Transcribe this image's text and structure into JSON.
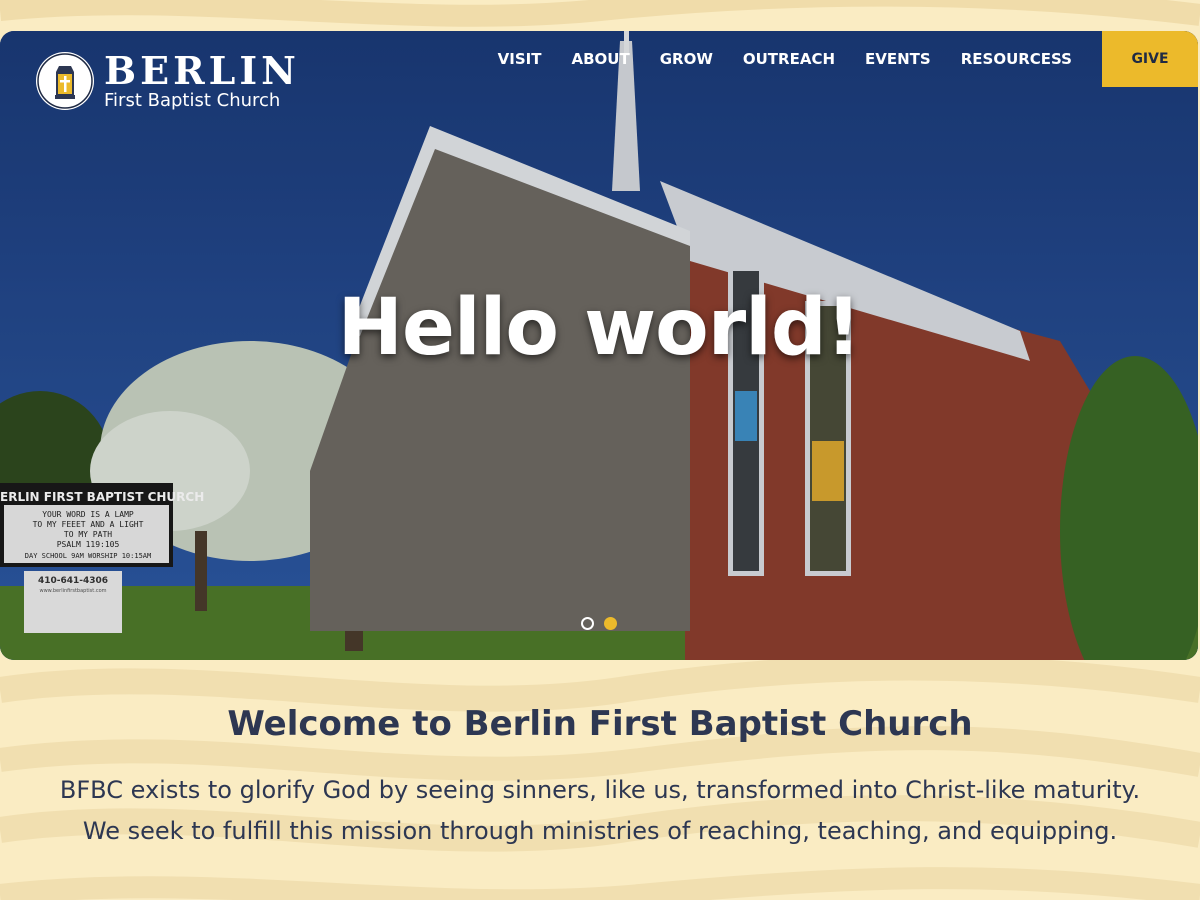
{
  "brand": {
    "name": "BERLIN",
    "subtitle": "First Baptist Church",
    "icon": "lamp-cross-icon"
  },
  "nav": {
    "items": [
      {
        "label": "VISIT"
      },
      {
        "label": "ABOUT"
      },
      {
        "label": "GROW"
      },
      {
        "label": "OUTREACH"
      },
      {
        "label": "EVENTS"
      },
      {
        "label": "RESOURCESS"
      }
    ],
    "give_label": "GIVE"
  },
  "hero": {
    "title": "Hello world!",
    "sign": {
      "header": "ERLIN FIRST BAPTIST CHURCH",
      "lines": [
        "YOUR WORD IS A LAMP",
        "TO MY FEEET AND A LIGHT",
        "TO MY PATH",
        "PSALM 119:105",
        "DAY SCHOOL 9AM WORSHIP 10:15AM"
      ],
      "phone": "410-641-4306",
      "site": "www.berlinfirstbaptist.com"
    },
    "slides": {
      "count": 2,
      "active": 2
    }
  },
  "welcome": {
    "title": "Welcome to Berlin First Baptist Church",
    "line1": "BFBC exists to glorify God by seeing sinners, like us, transformed into Christ-like maturity.",
    "line2": "We seek to fulfill this mission through ministries of reaching, teaching, and equipping."
  },
  "colors": {
    "page_bg": "#faecc3",
    "accent": "#ecba2b",
    "heading": "#2d3752",
    "sky": "#1d3f7f"
  }
}
